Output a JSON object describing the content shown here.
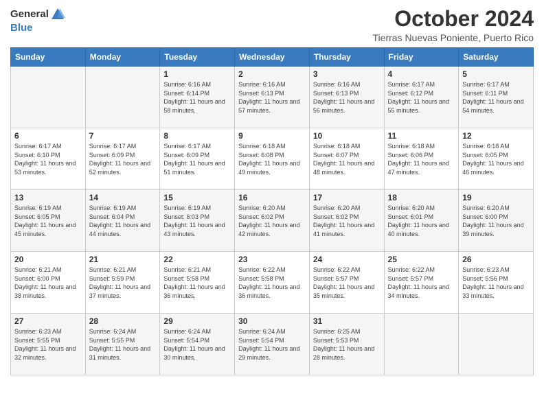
{
  "logo": {
    "line1": "General",
    "line2": "Blue"
  },
  "title": "October 2024",
  "location": "Tierras Nuevas Poniente, Puerto Rico",
  "days_of_week": [
    "Sunday",
    "Monday",
    "Tuesday",
    "Wednesday",
    "Thursday",
    "Friday",
    "Saturday"
  ],
  "weeks": [
    [
      {
        "day": "",
        "sunrise": "",
        "sunset": "",
        "daylight": ""
      },
      {
        "day": "",
        "sunrise": "",
        "sunset": "",
        "daylight": ""
      },
      {
        "day": "1",
        "sunrise": "Sunrise: 6:16 AM",
        "sunset": "Sunset: 6:14 PM",
        "daylight": "Daylight: 11 hours and 58 minutes."
      },
      {
        "day": "2",
        "sunrise": "Sunrise: 6:16 AM",
        "sunset": "Sunset: 6:13 PM",
        "daylight": "Daylight: 11 hours and 57 minutes."
      },
      {
        "day": "3",
        "sunrise": "Sunrise: 6:16 AM",
        "sunset": "Sunset: 6:13 PM",
        "daylight": "Daylight: 11 hours and 56 minutes."
      },
      {
        "day": "4",
        "sunrise": "Sunrise: 6:17 AM",
        "sunset": "Sunset: 6:12 PM",
        "daylight": "Daylight: 11 hours and 55 minutes."
      },
      {
        "day": "5",
        "sunrise": "Sunrise: 6:17 AM",
        "sunset": "Sunset: 6:11 PM",
        "daylight": "Daylight: 11 hours and 54 minutes."
      }
    ],
    [
      {
        "day": "6",
        "sunrise": "Sunrise: 6:17 AM",
        "sunset": "Sunset: 6:10 PM",
        "daylight": "Daylight: 11 hours and 53 minutes."
      },
      {
        "day": "7",
        "sunrise": "Sunrise: 6:17 AM",
        "sunset": "Sunset: 6:09 PM",
        "daylight": "Daylight: 11 hours and 52 minutes."
      },
      {
        "day": "8",
        "sunrise": "Sunrise: 6:17 AM",
        "sunset": "Sunset: 6:09 PM",
        "daylight": "Daylight: 11 hours and 51 minutes."
      },
      {
        "day": "9",
        "sunrise": "Sunrise: 6:18 AM",
        "sunset": "Sunset: 6:08 PM",
        "daylight": "Daylight: 11 hours and 49 minutes."
      },
      {
        "day": "10",
        "sunrise": "Sunrise: 6:18 AM",
        "sunset": "Sunset: 6:07 PM",
        "daylight": "Daylight: 11 hours and 48 minutes."
      },
      {
        "day": "11",
        "sunrise": "Sunrise: 6:18 AM",
        "sunset": "Sunset: 6:06 PM",
        "daylight": "Daylight: 11 hours and 47 minutes."
      },
      {
        "day": "12",
        "sunrise": "Sunrise: 6:18 AM",
        "sunset": "Sunset: 6:05 PM",
        "daylight": "Daylight: 11 hours and 46 minutes."
      }
    ],
    [
      {
        "day": "13",
        "sunrise": "Sunrise: 6:19 AM",
        "sunset": "Sunset: 6:05 PM",
        "daylight": "Daylight: 11 hours and 45 minutes."
      },
      {
        "day": "14",
        "sunrise": "Sunrise: 6:19 AM",
        "sunset": "Sunset: 6:04 PM",
        "daylight": "Daylight: 11 hours and 44 minutes."
      },
      {
        "day": "15",
        "sunrise": "Sunrise: 6:19 AM",
        "sunset": "Sunset: 6:03 PM",
        "daylight": "Daylight: 11 hours and 43 minutes."
      },
      {
        "day": "16",
        "sunrise": "Sunrise: 6:20 AM",
        "sunset": "Sunset: 6:02 PM",
        "daylight": "Daylight: 11 hours and 42 minutes."
      },
      {
        "day": "17",
        "sunrise": "Sunrise: 6:20 AM",
        "sunset": "Sunset: 6:02 PM",
        "daylight": "Daylight: 11 hours and 41 minutes."
      },
      {
        "day": "18",
        "sunrise": "Sunrise: 6:20 AM",
        "sunset": "Sunset: 6:01 PM",
        "daylight": "Daylight: 11 hours and 40 minutes."
      },
      {
        "day": "19",
        "sunrise": "Sunrise: 6:20 AM",
        "sunset": "Sunset: 6:00 PM",
        "daylight": "Daylight: 11 hours and 39 minutes."
      }
    ],
    [
      {
        "day": "20",
        "sunrise": "Sunrise: 6:21 AM",
        "sunset": "Sunset: 6:00 PM",
        "daylight": "Daylight: 11 hours and 38 minutes."
      },
      {
        "day": "21",
        "sunrise": "Sunrise: 6:21 AM",
        "sunset": "Sunset: 5:59 PM",
        "daylight": "Daylight: 11 hours and 37 minutes."
      },
      {
        "day": "22",
        "sunrise": "Sunrise: 6:21 AM",
        "sunset": "Sunset: 5:58 PM",
        "daylight": "Daylight: 11 hours and 36 minutes."
      },
      {
        "day": "23",
        "sunrise": "Sunrise: 6:22 AM",
        "sunset": "Sunset: 5:58 PM",
        "daylight": "Daylight: 11 hours and 36 minutes."
      },
      {
        "day": "24",
        "sunrise": "Sunrise: 6:22 AM",
        "sunset": "Sunset: 5:57 PM",
        "daylight": "Daylight: 11 hours and 35 minutes."
      },
      {
        "day": "25",
        "sunrise": "Sunrise: 6:22 AM",
        "sunset": "Sunset: 5:57 PM",
        "daylight": "Daylight: 11 hours and 34 minutes."
      },
      {
        "day": "26",
        "sunrise": "Sunrise: 6:23 AM",
        "sunset": "Sunset: 5:56 PM",
        "daylight": "Daylight: 11 hours and 33 minutes."
      }
    ],
    [
      {
        "day": "27",
        "sunrise": "Sunrise: 6:23 AM",
        "sunset": "Sunset: 5:55 PM",
        "daylight": "Daylight: 11 hours and 32 minutes."
      },
      {
        "day": "28",
        "sunrise": "Sunrise: 6:24 AM",
        "sunset": "Sunset: 5:55 PM",
        "daylight": "Daylight: 11 hours and 31 minutes."
      },
      {
        "day": "29",
        "sunrise": "Sunrise: 6:24 AM",
        "sunset": "Sunset: 5:54 PM",
        "daylight": "Daylight: 11 hours and 30 minutes."
      },
      {
        "day": "30",
        "sunrise": "Sunrise: 6:24 AM",
        "sunset": "Sunset: 5:54 PM",
        "daylight": "Daylight: 11 hours and 29 minutes."
      },
      {
        "day": "31",
        "sunrise": "Sunrise: 6:25 AM",
        "sunset": "Sunset: 5:53 PM",
        "daylight": "Daylight: 11 hours and 28 minutes."
      },
      {
        "day": "",
        "sunrise": "",
        "sunset": "",
        "daylight": ""
      },
      {
        "day": "",
        "sunrise": "",
        "sunset": "",
        "daylight": ""
      }
    ]
  ]
}
